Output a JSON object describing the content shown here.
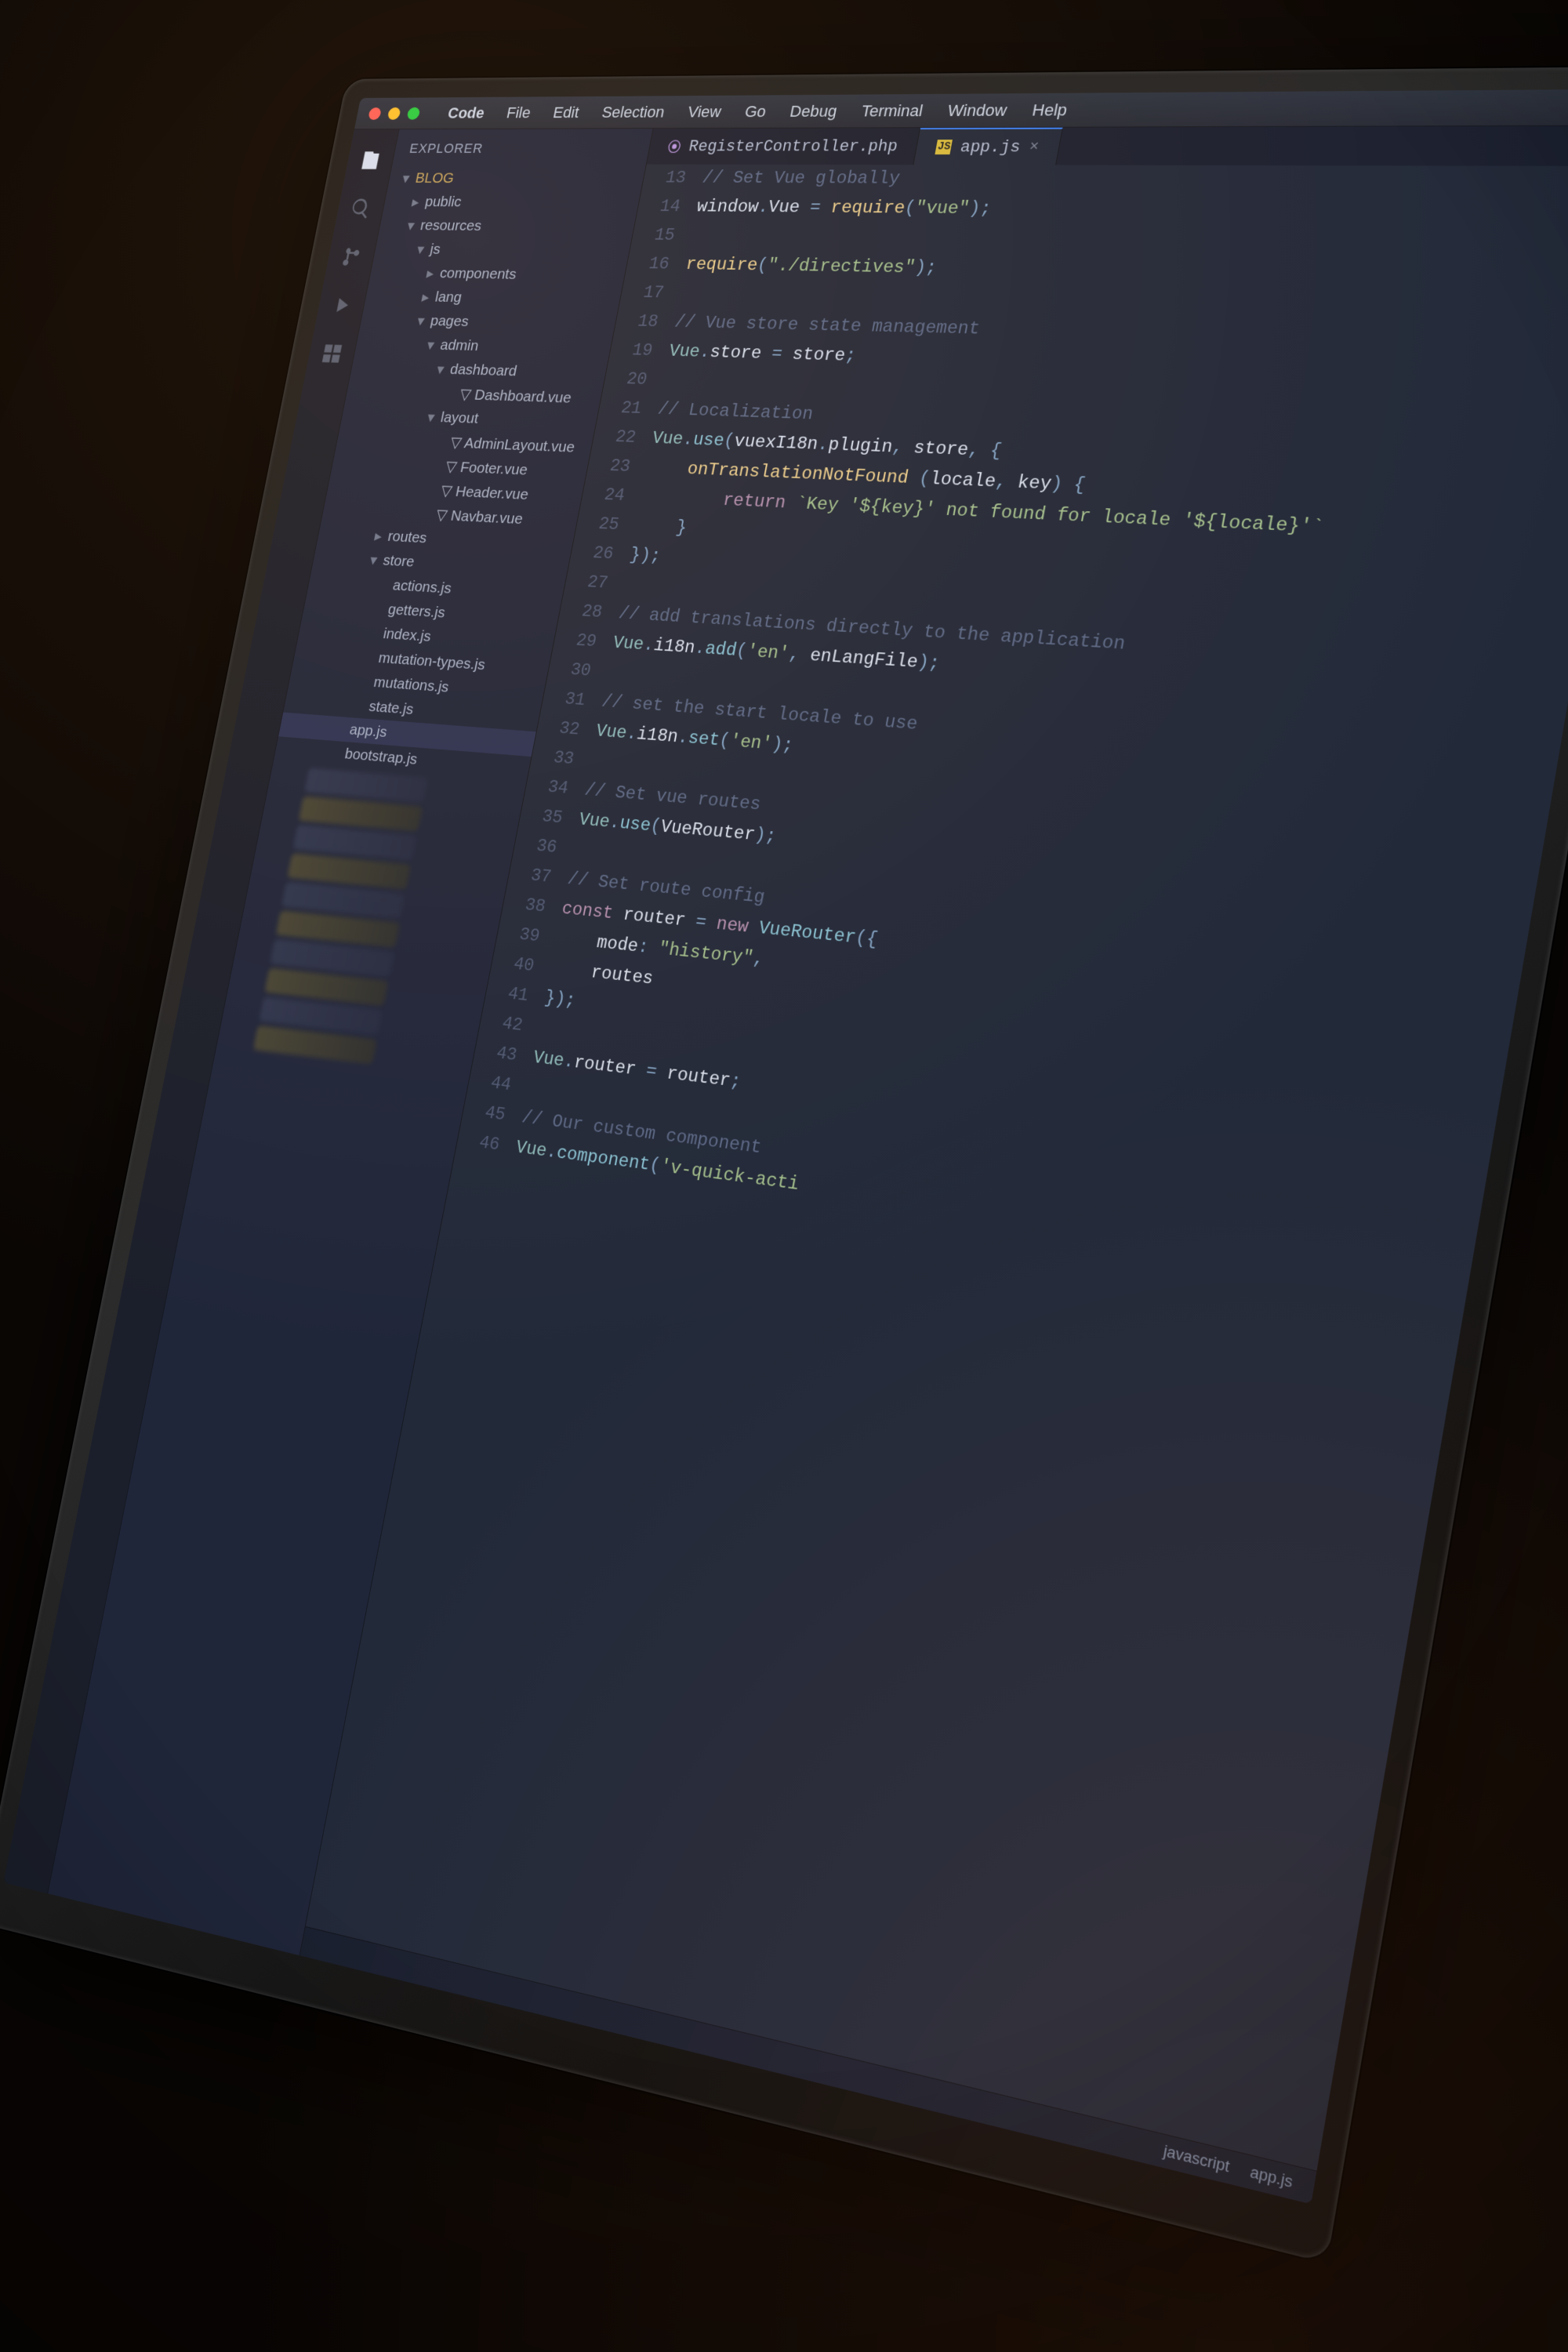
{
  "menubar": {
    "app": "Code",
    "items": [
      "File",
      "Edit",
      "Selection",
      "View",
      "Go",
      "Debug",
      "Terminal",
      "Window",
      "Help"
    ]
  },
  "sidebar": {
    "title": "EXPLORER",
    "root": "BLOG",
    "nodes": [
      {
        "label": "public",
        "kind": "folder",
        "depth": 1
      },
      {
        "label": "resources",
        "kind": "folder",
        "depth": 1,
        "open": true
      },
      {
        "label": "js",
        "kind": "folder",
        "depth": 2,
        "open": true
      },
      {
        "label": "components",
        "kind": "folder",
        "depth": 3
      },
      {
        "label": "lang",
        "kind": "folder",
        "depth": 3
      },
      {
        "label": "pages",
        "kind": "folder",
        "depth": 3,
        "open": true
      },
      {
        "label": "admin",
        "kind": "folder",
        "depth": 4,
        "open": true
      },
      {
        "label": "dashboard",
        "kind": "folder",
        "depth": 5,
        "open": true
      },
      {
        "label": "Dashboard.vue",
        "kind": "vue",
        "depth": 6
      },
      {
        "label": "layout",
        "kind": "folder",
        "depth": 5,
        "open": true
      },
      {
        "label": "AdminLayout.vue",
        "kind": "vue",
        "depth": 6
      },
      {
        "label": "Footer.vue",
        "kind": "vue",
        "depth": 6
      },
      {
        "label": "Header.vue",
        "kind": "vue",
        "depth": 6
      },
      {
        "label": "Navbar.vue",
        "kind": "vue",
        "depth": 6
      },
      {
        "label": "routes",
        "kind": "folder",
        "depth": 3
      },
      {
        "label": "store",
        "kind": "folder",
        "depth": 3,
        "open": true
      },
      {
        "label": "actions.js",
        "kind": "js",
        "depth": 4
      },
      {
        "label": "getters.js",
        "kind": "js",
        "depth": 4
      },
      {
        "label": "index.js",
        "kind": "js",
        "depth": 4
      },
      {
        "label": "mutation-types.js",
        "kind": "js",
        "depth": 4
      },
      {
        "label": "mutations.js",
        "kind": "js",
        "depth": 4
      },
      {
        "label": "state.js",
        "kind": "js",
        "depth": 4
      },
      {
        "label": "app.js",
        "kind": "js",
        "depth": 3,
        "selected": true
      },
      {
        "label": "bootstrap.js",
        "kind": "js",
        "depth": 3
      }
    ]
  },
  "tabs": [
    {
      "label": "RegisterController.php",
      "kind": "php",
      "active": false
    },
    {
      "label": "app.js",
      "kind": "js",
      "active": true
    }
  ],
  "code": {
    "start": 13,
    "lines": [
      {
        "t": [
          [
            "cm",
            "// Set Vue globally"
          ]
        ]
      },
      {
        "t": [
          [
            "id",
            "window"
          ],
          [
            "op",
            "."
          ],
          [
            "id",
            "Vue"
          ],
          [
            "op",
            " = "
          ],
          [
            "yl",
            "require"
          ],
          [
            "op",
            "("
          ],
          [
            "str",
            "\"vue\""
          ],
          [
            "op",
            ");"
          ]
        ]
      },
      {
        "t": []
      },
      {
        "t": [
          [
            "yl",
            "require"
          ],
          [
            "op",
            "("
          ],
          [
            "str",
            "\"./directives\""
          ],
          [
            "op",
            ");"
          ]
        ]
      },
      {
        "t": []
      },
      {
        "t": [
          [
            "cm",
            "// Vue store state management"
          ]
        ]
      },
      {
        "t": [
          [
            "obj",
            "Vue"
          ],
          [
            "op",
            "."
          ],
          [
            "id",
            "store"
          ],
          [
            "op",
            " = "
          ],
          [
            "id",
            "store"
          ],
          [
            "op",
            ";"
          ]
        ]
      },
      {
        "t": []
      },
      {
        "t": [
          [
            "cm",
            "// Localization"
          ]
        ]
      },
      {
        "t": [
          [
            "obj",
            "Vue"
          ],
          [
            "op",
            "."
          ],
          [
            "fn",
            "use"
          ],
          [
            "op",
            "("
          ],
          [
            "id",
            "vuexI18n"
          ],
          [
            "op",
            "."
          ],
          [
            "id",
            "plugin"
          ],
          [
            "op",
            ", "
          ],
          [
            "id",
            "store"
          ],
          [
            "op",
            ", {"
          ]
        ]
      },
      {
        "t": [
          [
            "id",
            "    "
          ],
          [
            "yl",
            "onTranslationNotFound"
          ],
          [
            "op",
            " ("
          ],
          [
            "id",
            "locale"
          ],
          [
            "op",
            ", "
          ],
          [
            "id",
            "key"
          ],
          [
            "op",
            ") {"
          ]
        ]
      },
      {
        "t": [
          [
            "id",
            "        "
          ],
          [
            "kw",
            "return"
          ],
          [
            "id",
            " "
          ],
          [
            "str",
            "`Key '${key}' not found for locale '${locale}'`"
          ]
        ]
      },
      {
        "t": [
          [
            "op",
            "    }"
          ]
        ]
      },
      {
        "t": [
          [
            "op",
            "});"
          ]
        ]
      },
      {
        "t": []
      },
      {
        "t": [
          [
            "cm",
            "// add translations directly to the application"
          ]
        ]
      },
      {
        "t": [
          [
            "obj",
            "Vue"
          ],
          [
            "op",
            "."
          ],
          [
            "id",
            "i18n"
          ],
          [
            "op",
            "."
          ],
          [
            "fn",
            "add"
          ],
          [
            "op",
            "("
          ],
          [
            "str",
            "'en'"
          ],
          [
            "op",
            ", "
          ],
          [
            "id",
            "enLangFile"
          ],
          [
            "op",
            ");"
          ]
        ]
      },
      {
        "t": []
      },
      {
        "t": [
          [
            "cm",
            "// set the start locale to use"
          ]
        ]
      },
      {
        "t": [
          [
            "obj",
            "Vue"
          ],
          [
            "op",
            "."
          ],
          [
            "id",
            "i18n"
          ],
          [
            "op",
            "."
          ],
          [
            "fn",
            "set"
          ],
          [
            "op",
            "("
          ],
          [
            "str",
            "'en'"
          ],
          [
            "op",
            ");"
          ]
        ]
      },
      {
        "t": []
      },
      {
        "t": [
          [
            "cm",
            "// Set vue routes"
          ]
        ]
      },
      {
        "t": [
          [
            "obj",
            "Vue"
          ],
          [
            "op",
            "."
          ],
          [
            "fn",
            "use"
          ],
          [
            "op",
            "("
          ],
          [
            "id",
            "VueRouter"
          ],
          [
            "op",
            ");"
          ]
        ]
      },
      {
        "t": []
      },
      {
        "t": [
          [
            "cm",
            "// Set route config"
          ]
        ]
      },
      {
        "t": [
          [
            "kw",
            "const"
          ],
          [
            "id",
            " router "
          ],
          [
            "op",
            "= "
          ],
          [
            "kw",
            "new"
          ],
          [
            "id",
            " "
          ],
          [
            "fn",
            "VueRouter"
          ],
          [
            "op",
            "({"
          ]
        ]
      },
      {
        "t": [
          [
            "id",
            "    mode"
          ],
          [
            "op",
            ": "
          ],
          [
            "str",
            "\"history\""
          ],
          [
            "op",
            ","
          ]
        ]
      },
      {
        "t": [
          [
            "id",
            "    routes"
          ]
        ]
      },
      {
        "t": [
          [
            "op",
            "});"
          ]
        ]
      },
      {
        "t": []
      },
      {
        "t": [
          [
            "obj",
            "Vue"
          ],
          [
            "op",
            "."
          ],
          [
            "id",
            "router"
          ],
          [
            "op",
            " = "
          ],
          [
            "id",
            "router"
          ],
          [
            "op",
            ";"
          ]
        ]
      },
      {
        "t": []
      },
      {
        "t": [
          [
            "cm",
            "// Our custom component"
          ]
        ]
      },
      {
        "t": [
          [
            "obj",
            "Vue"
          ],
          [
            "op",
            "."
          ],
          [
            "fn",
            "component"
          ],
          [
            "op",
            "("
          ],
          [
            "str",
            "'v-quick-acti"
          ]
        ]
      }
    ]
  },
  "statusbar": {
    "items": [
      "javascript",
      "app.js"
    ]
  }
}
